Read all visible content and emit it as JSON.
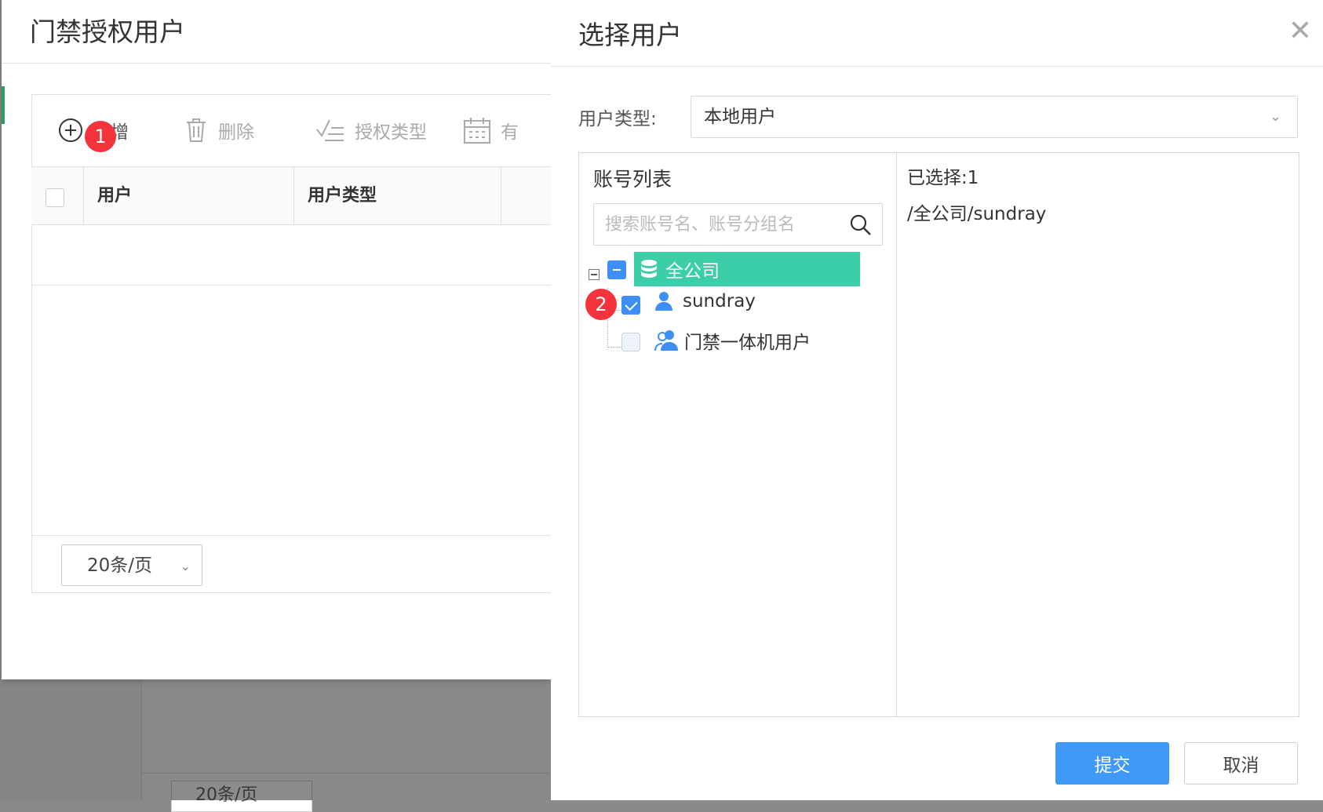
{
  "background": {
    "page_size_label": "20条/页"
  },
  "authorized_panel": {
    "title": "门禁授权用户",
    "toolbar": {
      "add_label": "新增",
      "delete_label": "删除",
      "auth_type_label": "授权类型",
      "validity_label_partial": "有"
    },
    "table": {
      "columns": [
        "用户",
        "用户类型"
      ]
    },
    "page_size": "20条/页"
  },
  "annotations": {
    "badge_1": "1",
    "badge_2": "2"
  },
  "modal": {
    "title": "选择用户",
    "user_type": {
      "label": "用户类型:",
      "value": "本地用户"
    },
    "account_list": {
      "title": "账号列表",
      "search_placeholder": "搜索账号名、账号分组名",
      "tree": {
        "root": {
          "label": "全公司",
          "state": "partial",
          "selected": true
        },
        "children": [
          {
            "label": "sundray",
            "state": "checked",
            "icon": "user-icon"
          },
          {
            "label": "门禁一体机用户",
            "state": "unchecked",
            "icon": "user-group-icon"
          }
        ]
      }
    },
    "selected": {
      "title": "已选择:1",
      "items": [
        "/全公司/sundray"
      ]
    },
    "buttons": {
      "submit": "提交",
      "cancel": "取消"
    }
  },
  "colors": {
    "tree_selected": "#3bcea9",
    "primary": "#3e99f7",
    "checkbox": "#3e8ef7",
    "badge": "#f4333c",
    "user_icon": "#3e8ef7"
  }
}
